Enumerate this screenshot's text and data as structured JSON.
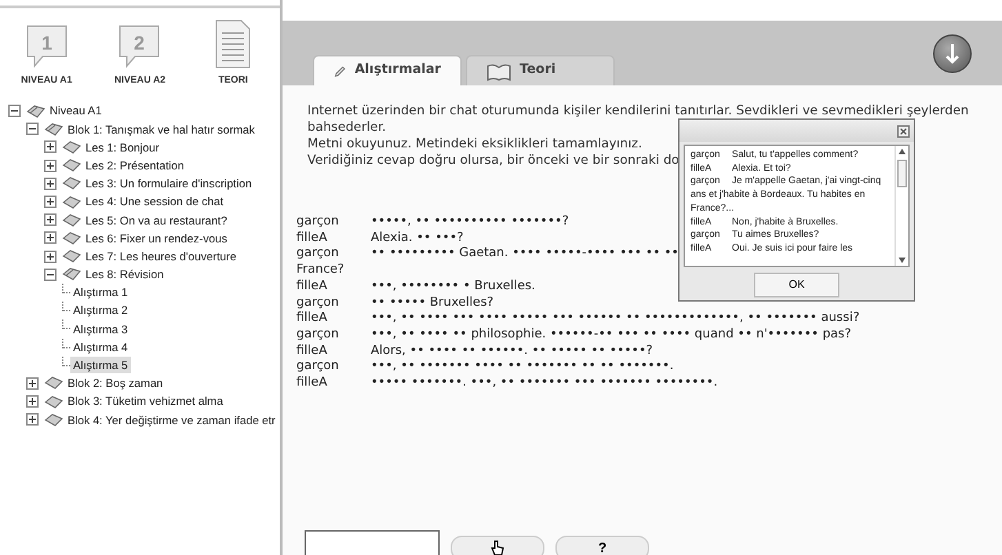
{
  "levels": [
    {
      "kind": "level",
      "number": "1",
      "label": "NIVEAU A1"
    },
    {
      "kind": "level",
      "number": "2",
      "label": "NIVEAU A2"
    },
    {
      "kind": "document",
      "label": "TEORI"
    }
  ],
  "tree": [
    {
      "label": "Niveau A1",
      "expanded": true,
      "children": [
        {
          "label": "Blok 1: Tanışmak ve hal hatır sormak",
          "expanded": true,
          "children": [
            {
              "label": "Les 1: Bonjour",
              "expanded": false
            },
            {
              "label": "Les 2: Présentation",
              "expanded": false
            },
            {
              "label": "Les 3: Un formulaire d'inscription",
              "expanded": false
            },
            {
              "label": "Les 4: Une session de chat",
              "expanded": false
            },
            {
              "label": "Les 5: On va au restaurant?",
              "expanded": false
            },
            {
              "label": "Les 6: Fixer un rendez-vous",
              "expanded": false
            },
            {
              "label": "Les 7: Les heures d'ouverture",
              "expanded": false
            },
            {
              "label": "Les 8: Révision",
              "expanded": true,
              "children": [
                {
                  "label": "Alıştırma 1",
                  "selected": false
                },
                {
                  "label": "Alıştırma 2",
                  "selected": false
                },
                {
                  "label": "Alıştırma 3",
                  "selected": false
                },
                {
                  "label": "Alıştırma 4",
                  "selected": false
                },
                {
                  "label": "Alıştırma 5",
                  "selected": true
                }
              ]
            }
          ]
        },
        {
          "label": "Blok 2: Boş zaman",
          "expanded": false
        },
        {
          "label": "Blok 3: Tüketim vehizmet alma",
          "expanded": false
        },
        {
          "label": "Blok 4: Yer değiştirme ve zaman ifade etr",
          "expanded": false
        }
      ]
    }
  ],
  "tabs": [
    {
      "kind": "exercise",
      "label": "Alıştırmalar",
      "selected": true
    },
    {
      "kind": "theory",
      "label": "Teori",
      "selected": false
    }
  ],
  "instructions": [
    "Internet üzerinden bir chat oturumunda kişiler kendilerini tanıtırlar. Sevdikleri ve sevmedikleri şeylerden",
    "bahsederler.",
    "Metni okuyunuz. Metindeki eksiklikleri tamamlayınız.",
    "Veridiğiniz cevap doğru olursa, bir önceki ve bir sonraki do"
  ],
  "dialogue": [
    {
      "speaker": "garçon",
      "text": "•••••, •• •••••••••• •••••••?"
    },
    {
      "speaker": "filleA",
      "text": "Alexia. •• •••?"
    },
    {
      "speaker": "garçon",
      "text": "•• ••••••••• Gaetan. •••• •••••-•••• ••• •• ••",
      "continuation": "France?"
    },
    {
      "speaker": "filleA",
      "text": "•••, •••••••• • Bruxelles."
    },
    {
      "speaker": "garçon",
      "text": "•• ••••• Bruxelles?"
    },
    {
      "speaker": "filleA",
      "text": "•••, •• •••• ••• •••• ••••• ••• •••••• •• •••••••••••••, •• ••••••• aussi?"
    },
    {
      "speaker": "garçon",
      "text": "•••, •• •••• •• philosophie. ••••••-•• ••• •• •••• quand •• n'••••••• pas?"
    },
    {
      "speaker": "filleA",
      "text": "Alors, •• •••• •• ••••••. •• ••••• •• •••••?"
    },
    {
      "speaker": "garçon",
      "text": "•••, •• ••••••• •••• •• ••••••• •• •• •••••••."
    },
    {
      "speaker": "filleA",
      "text": "••••• •••••••. •••, •• ••••••• ••• ••••••• ••••••••."
    }
  ],
  "popup": {
    "lines": [
      {
        "speaker": "garçon",
        "text": "Salut, tu t'appelles comment?"
      },
      {
        "speaker": "filleA",
        "text": "Alexia. Et toi?"
      },
      {
        "speaker": "garçon",
        "text": "Je m'appelle Gaetan, j'ai vingt-cinq ans et j'habite à Bordeaux. Tu habites en France?..."
      },
      {
        "speaker": "filleA",
        "text": "Non, j'habite à Bruxelles."
      },
      {
        "speaker": "garçon",
        "text": "Tu aimes Bruxelles?"
      },
      {
        "speaker": "filleA",
        "text": "Oui. Je suis ici pour faire les"
      }
    ],
    "button": "OK"
  },
  "bottom": {
    "buttons": [
      {
        "kind": "pointer"
      },
      {
        "kind": "text",
        "label": "?"
      }
    ]
  }
}
